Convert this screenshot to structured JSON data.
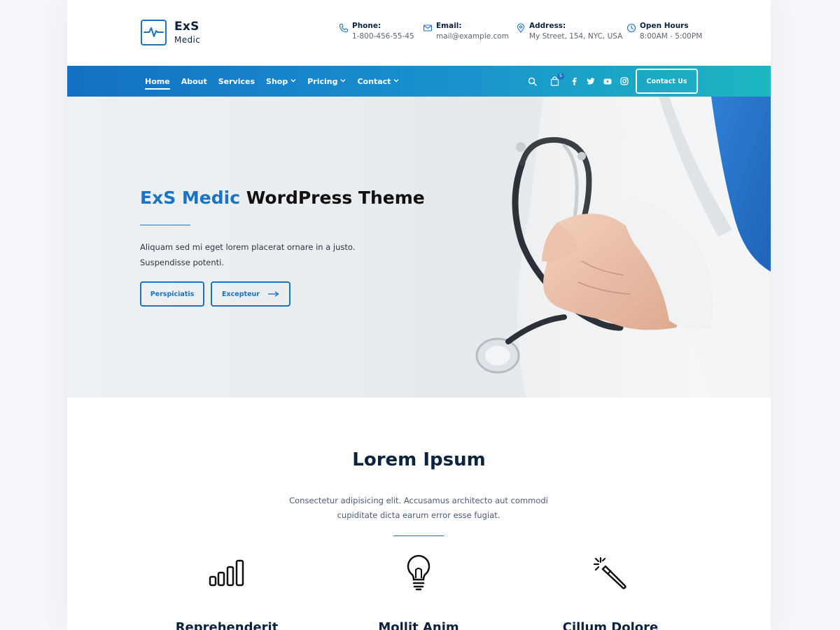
{
  "brand": {
    "name": "ExS",
    "tagline": "Medic"
  },
  "contacts": [
    {
      "icon": "phone-icon",
      "label": "Phone:",
      "value": "1-800-456-55-45"
    },
    {
      "icon": "email-icon",
      "label": "Email:",
      "value": "mail@example.com"
    },
    {
      "icon": "location-icon",
      "label": "Address:",
      "value": "My Street, 154, NYC, USA"
    },
    {
      "icon": "clock-icon",
      "label": "Open Hours",
      "value": "8:00AM - 5:00PM"
    }
  ],
  "nav": {
    "items": [
      {
        "label": "Home",
        "active": true
      },
      {
        "label": "About"
      },
      {
        "label": "Services"
      },
      {
        "label": "Shop",
        "dropdown": true
      },
      {
        "label": "Pricing",
        "dropdown": true
      },
      {
        "label": "Contact",
        "dropdown": true
      }
    ],
    "cart_count": "5",
    "contact_button": "Contact Us"
  },
  "hero": {
    "title_accent": "ExS Medic",
    "title_rest": "WordPress Theme",
    "text": "Aliquam sed mi eget lorem placerat ornare in a justo. Suspendisse potenti.",
    "button_primary": "Perspiciatis",
    "button_secondary": "Excepteur"
  },
  "features_section": {
    "title": "Lorem Ipsum",
    "text": "Consectetur adipisicing elit. Accusamus architecto aut commodi cupiditate dicta earum error esse fugiat.",
    "items": [
      {
        "icon": "signal-bars-icon",
        "title": "Reprehenderit"
      },
      {
        "icon": "lightbulb-icon",
        "title": "Mollit Anim"
      },
      {
        "icon": "magic-wand-icon",
        "title": "Cillum Dolore"
      }
    ]
  },
  "colors": {
    "accent": "#1a73c4",
    "nav_start": "#1371c4",
    "nav_end": "#1cb7c0",
    "heading": "#0c2340"
  }
}
